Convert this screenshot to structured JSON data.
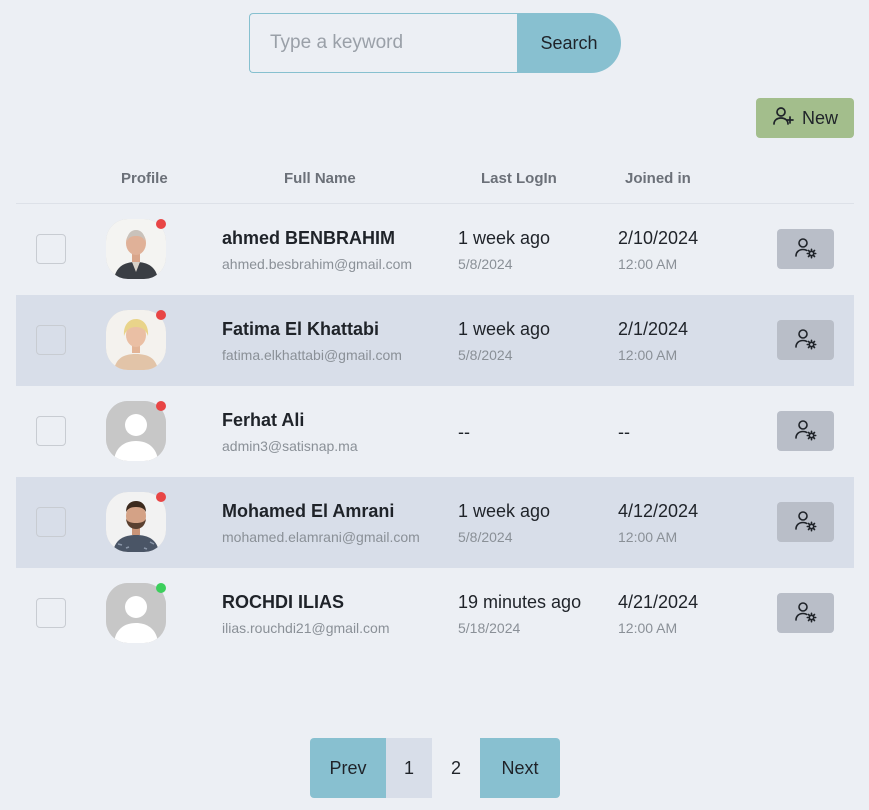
{
  "search": {
    "placeholder": "Type a keyword",
    "button_label": "Search"
  },
  "toolbar": {
    "new_label": "New",
    "new_icon": "user-plus-icon"
  },
  "table": {
    "headers": {
      "profile": "Profile",
      "full_name": "Full Name",
      "last_login": "Last LogIn",
      "joined_in": "Joined in"
    },
    "rows": [
      {
        "name": "ahmed BENBRAHIM",
        "email": "ahmed.besbrahim@gmail.com",
        "last_login": "1 week ago",
        "last_login_date": "5/8/2024",
        "joined_date": "2/10/2024",
        "joined_time": "12:00 AM",
        "status": "offline",
        "avatar": "photo"
      },
      {
        "name": "Fatima El Khattabi",
        "email": "fatima.elkhattabi@gmail.com",
        "last_login": "1 week ago",
        "last_login_date": "5/8/2024",
        "joined_date": "2/1/2024",
        "joined_time": "12:00 AM",
        "status": "offline",
        "avatar": "photo"
      },
      {
        "name": "Ferhat Ali",
        "email": "admin3@satisnap.ma",
        "last_login": "--",
        "joined_date": "--",
        "status": "offline",
        "avatar": "placeholder"
      },
      {
        "name": "Mohamed El Amrani",
        "email": "mohamed.elamrani@gmail.com",
        "last_login": "1 week ago",
        "last_login_date": "5/8/2024",
        "joined_date": "4/12/2024",
        "joined_time": "12:00 AM",
        "status": "offline",
        "avatar": "photo"
      },
      {
        "name": "ROCHDI ILIAS",
        "email": "ilias.rouchdi21@gmail.com",
        "last_login": "19 minutes ago",
        "last_login_date": "5/18/2024",
        "joined_date": "4/21/2024",
        "joined_time": "12:00 AM",
        "status": "online",
        "avatar": "placeholder"
      }
    ]
  },
  "pagination": {
    "prev_label": "Prev",
    "pages": [
      "1",
      "2"
    ],
    "current_page": "2",
    "next_label": "Next"
  },
  "colors": {
    "background": "#eceff4",
    "accent": "#88c0d0",
    "new_button": "#a3be8c",
    "row_alt": "#d8dee9",
    "status_offline": "#e84545",
    "status_online": "#3ccf5c",
    "manage_button": "#b9bec8"
  }
}
